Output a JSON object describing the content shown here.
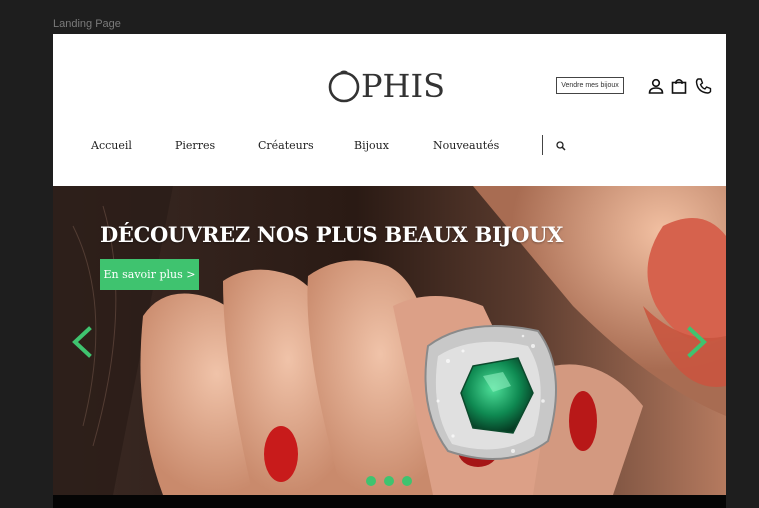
{
  "canvas": {
    "frame_label": "Landing Page"
  },
  "header": {
    "logo_text": "PHIS",
    "sell_button": "Vendre mes bijoux",
    "icons": [
      "user-icon",
      "shopping-bag-icon",
      "phone-icon"
    ]
  },
  "nav": {
    "items": [
      "Accueil",
      "Pierres",
      "Créateurs",
      "Bijoux",
      "Nouveautés"
    ],
    "search_icon": "search-icon"
  },
  "hero": {
    "title": "DÉCOUVREZ NOS PLUS BEAUX BIJOUX",
    "cta_label": "En savoir plus >",
    "slides": 3,
    "active_slide": 1
  },
  "colors": {
    "accent": "#3fc36f",
    "page_bg": "#ffffff",
    "canvas_bg": "#1e1e1e",
    "text": "#222222"
  }
}
